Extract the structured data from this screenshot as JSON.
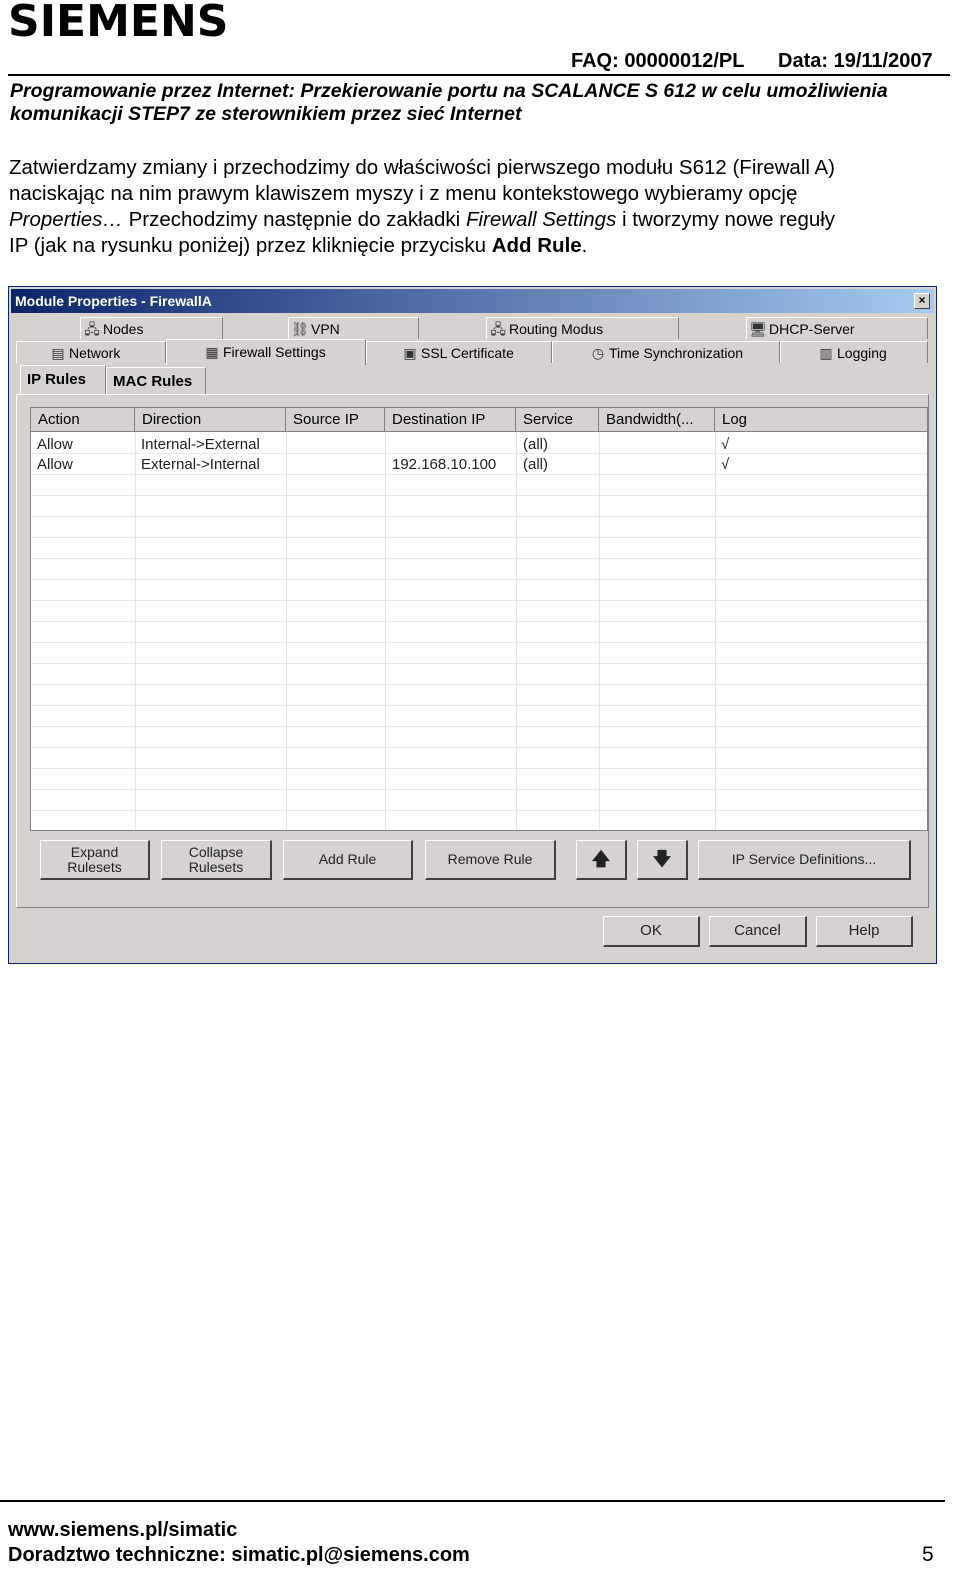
{
  "header": {
    "logo": "SIEMENS",
    "faq": "FAQ: 00000012/PL",
    "date": "Data: 19/11/2007",
    "title_line1": "Programowanie przez Internet: Przekierowanie portu na SCALANCE S 612 w celu umożliwienia",
    "title_line2": "komunikacji STEP7 ze sterownikiem przez sieć Internet"
  },
  "body": {
    "p1": "Zatwierdzamy zmiany i przechodzimy do właściwości pierwszego modułu S612 (Firewall A)",
    "p2": "naciskając na nim prawym klawiszem myszy i z menu kontekstowego wybieramy opcję",
    "p3_italic": "Properties…",
    "p3_mid": " Przechodzimy następnie do zakładki ",
    "p3_italic2": "Firewall Settings",
    "p3_end": " i tworzymy nowe reguły",
    "p4_start": "IP (jak na rysunku poniżej) przez kliknięcie przycisku ",
    "p4_bold": "Add Rule",
    "p4_end": "."
  },
  "dialog": {
    "title": "Module Properties - FirewallA",
    "close": "×",
    "tabs_row1": [
      "Nodes",
      "VPN",
      "Routing Modus",
      "DHCP-Server"
    ],
    "tabs_row2": [
      "Network",
      "Firewall Settings",
      "SSL Certificate",
      "Time Synchronization",
      "Logging"
    ],
    "subtabs": [
      "IP Rules",
      "MAC Rules"
    ],
    "columns": [
      "Action",
      "Direction",
      "Source IP",
      "Destination IP",
      "Service",
      "Bandwidth(...",
      "Log"
    ],
    "rows": [
      {
        "action": "Allow",
        "direction": "Internal->External",
        "source": "",
        "dest": "",
        "service": "(all)",
        "bandwidth": "",
        "log": "√"
      },
      {
        "action": "Allow",
        "direction": "External->Internal",
        "source": "",
        "dest": "192.168.10.100",
        "service": "(all)",
        "bandwidth": "",
        "log": "√"
      }
    ],
    "buttons": {
      "expand_l1": "Expand",
      "expand_l2": "Rulesets",
      "collapse_l1": "Collapse",
      "collapse_l2": "Rulesets",
      "add": "Add Rule",
      "remove": "Remove Rule",
      "up": "🡅",
      "down": "🡇",
      "service_defs": "IP Service Definitions...",
      "ok": "OK",
      "cancel": "Cancel",
      "help": "Help"
    }
  },
  "footer": {
    "url": "www.siemens.pl/simatic",
    "support": "Doradztwo techniczne: simatic.pl@siemens.com",
    "page": "5"
  }
}
